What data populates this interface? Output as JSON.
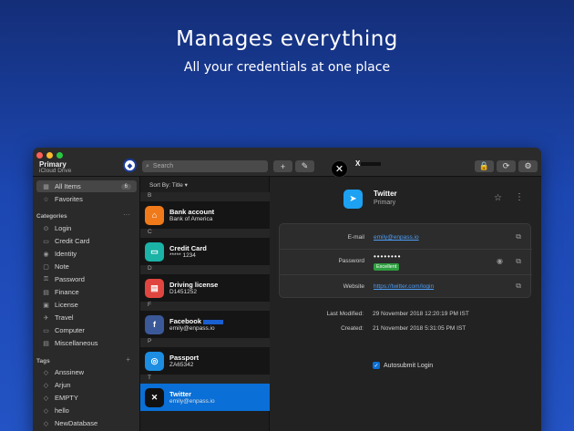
{
  "hero": {
    "title": "Manages everything",
    "subtitle": "All your credentials at one place"
  },
  "toolbar": {
    "vault_name": "Primary",
    "vault_location": "iCloud Drive",
    "search_placeholder": "Search",
    "add_label": "+",
    "edit_label": "✎",
    "tab_label": "X",
    "lock_label": "🔒",
    "sync_label": "⟳",
    "settings_label": "⚙"
  },
  "sidebar": {
    "all_items": {
      "label": "All Items",
      "count": "6"
    },
    "favorites": "Favorites",
    "categories_header": "Categories",
    "categories": [
      "Login",
      "Credit Card",
      "Identity",
      "Note",
      "Password",
      "Finance",
      "License",
      "Travel",
      "Computer",
      "Miscellaneous"
    ],
    "tags_header": "Tags",
    "tags": [
      "Anssinew",
      "Arjun",
      "EMPTY",
      "hello",
      "NewDatabase"
    ]
  },
  "list": {
    "sort_label": "Sort By:  Title",
    "letters": [
      "B",
      "C",
      "D",
      "F",
      "P",
      "T"
    ],
    "items": [
      {
        "title": "Bank account",
        "subtitle": "Bank of America",
        "color": "#f07a1a"
      },
      {
        "title": "Credit Card",
        "subtitle": "***** 1234",
        "color": "#1ab3a6"
      },
      {
        "title": "Driving license",
        "subtitle": "D1451252",
        "color": "#e0463f"
      },
      {
        "title": "Facebook",
        "subtitle": "emily@enpass.io",
        "color": "#3b5998"
      },
      {
        "title": "Passport",
        "subtitle": "ZA65342",
        "color": "#1c8de0"
      },
      {
        "title": "Twitter",
        "subtitle": "emily@enpass.io",
        "color": "#111111"
      }
    ]
  },
  "detail": {
    "title": "Twitter",
    "subtitle": "Primary",
    "fields": {
      "email_label": "E-mail",
      "email_value": "emily@enpass.io",
      "password_label": "Password",
      "password_value": "••••••••",
      "password_strength": "Excellent",
      "website_label": "Website",
      "website_value": "https://twitter.com/login"
    },
    "last_modified_label": "Last Modified:",
    "last_modified_value": "29 November 2018 12:20:19 PM IST",
    "created_label": "Created:",
    "created_value": "21 November 2018 5:31:05 PM IST",
    "autosubmit_label": "Autosubmit Login"
  }
}
